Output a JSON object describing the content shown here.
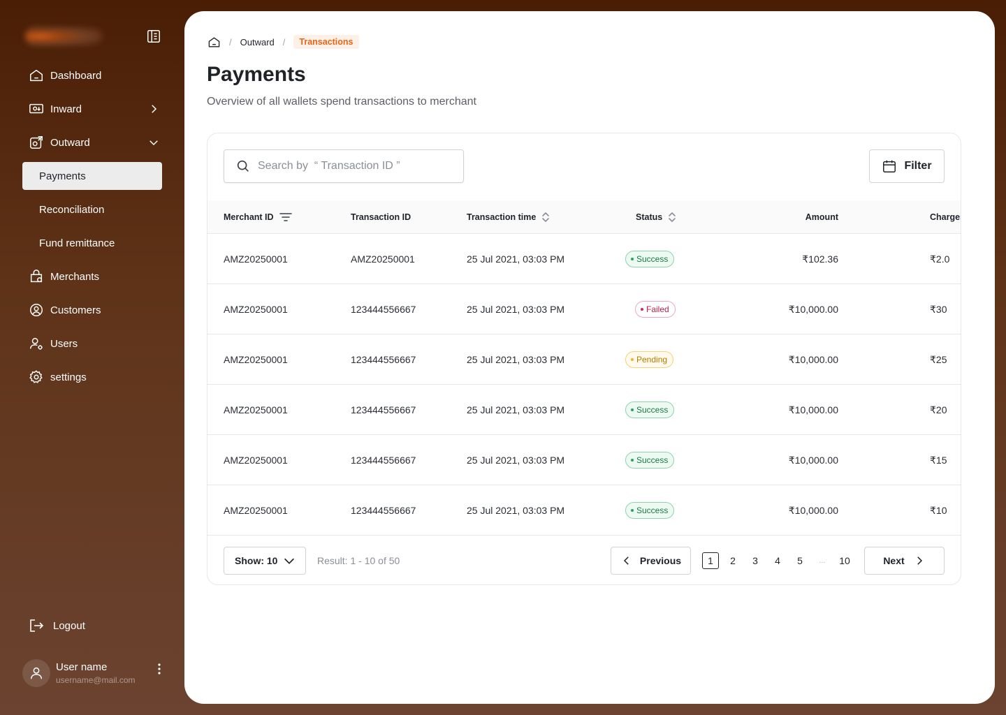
{
  "sidebar": {
    "nav": [
      {
        "label": "Dashboard",
        "icon": "home-icon"
      },
      {
        "label": "Inward",
        "icon": "inward-icon"
      },
      {
        "label": "Outward",
        "icon": "outward-icon"
      },
      {
        "label": "Payments"
      },
      {
        "label": "Reconciliation"
      },
      {
        "label": "Fund remittance"
      },
      {
        "label": "Merchants",
        "icon": "merchants-icon"
      },
      {
        "label": "Customers",
        "icon": "customers-icon"
      },
      {
        "label": "Users",
        "icon": "users-icon"
      },
      {
        "label": "settings",
        "icon": "gear-icon"
      }
    ],
    "logout_label": "Logout",
    "user": {
      "name": "User name",
      "email": "username@mail.com"
    }
  },
  "breadcrumb": {
    "items": [
      "Outward",
      "Transactions"
    ]
  },
  "page": {
    "title": "Payments",
    "subtitle": "Overview of all wallets spend transactions to merchant"
  },
  "search": {
    "placeholder": "Search by  “ Transaction ID ”"
  },
  "filter_label": "Filter",
  "table": {
    "columns": [
      "Merchant ID",
      "Transaction ID",
      "Transaction time",
      "Status",
      "Amount",
      "Charges"
    ],
    "rows": [
      {
        "merchant_id": "AMZ20250001",
        "transaction_id": "AMZ20250001",
        "time": "25 Jul 2021, 03:03 PM",
        "status": "Success",
        "amount": "₹102.36",
        "charges": "₹2.0"
      },
      {
        "merchant_id": "AMZ20250001",
        "transaction_id": "123444556667",
        "time": "25 Jul 2021, 03:03 PM",
        "status": "Failed",
        "amount": "₹10,000.00",
        "charges": "₹30"
      },
      {
        "merchant_id": "AMZ20250001",
        "transaction_id": "123444556667",
        "time": "25 Jul 2021, 03:03 PM",
        "status": "Pending",
        "amount": "₹10,000.00",
        "charges": "₹25"
      },
      {
        "merchant_id": "AMZ20250001",
        "transaction_id": "123444556667",
        "time": "25 Jul 2021, 03:03 PM",
        "status": "Success",
        "amount": "₹10,000.00",
        "charges": "₹20"
      },
      {
        "merchant_id": "AMZ20250001",
        "transaction_id": "123444556667",
        "time": "25 Jul 2021, 03:03 PM",
        "status": "Success",
        "amount": "₹10,000.00",
        "charges": "₹15"
      },
      {
        "merchant_id": "AMZ20250001",
        "transaction_id": "123444556667",
        "time": "25 Jul 2021, 03:03 PM",
        "status": "Success",
        "amount": "₹10,000.00",
        "charges": "₹10"
      }
    ]
  },
  "pagination": {
    "show_label": "Show: 10",
    "result_text": "Result: 1 - 10 of 50",
    "previous_label": "Previous",
    "next_label": "Next",
    "pages": [
      "1",
      "2",
      "3",
      "4",
      "5",
      "...",
      "10"
    ],
    "current_page": "1"
  },
  "colors": {
    "accent": "#e8651a",
    "success": "#22a55a",
    "failed": "#d4245a",
    "pending": "#f0b619"
  }
}
